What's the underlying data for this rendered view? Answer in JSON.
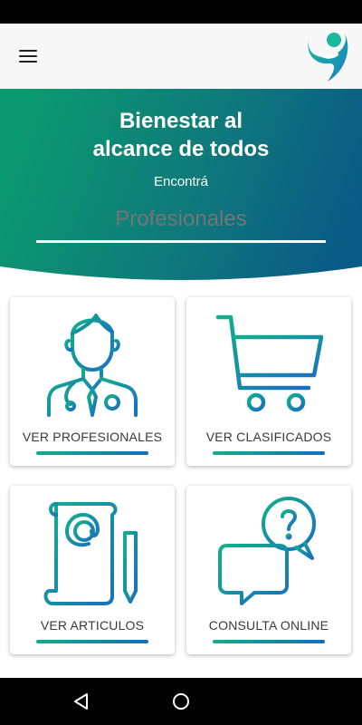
{
  "hero": {
    "title_line1": "Bienestar al",
    "title_line2": "alcance de todos",
    "subtitle": "Encontrá",
    "search_placeholder": "Profesionales"
  },
  "cards": [
    {
      "label": "VER PROFESIONALES",
      "icon": "doctor-icon"
    },
    {
      "label": "VER CLASIFICADOS",
      "icon": "shopping-cart-icon"
    },
    {
      "label": "VER ARTICULOS",
      "icon": "article-document-icon"
    },
    {
      "label": "CONSULTA ONLINE",
      "icon": "chat-question-icon"
    }
  ],
  "colors": {
    "gradient_start": "#0fae8c",
    "gradient_end": "#1470b8",
    "hero_start": "#0b9a6f",
    "hero_end": "#0a5a86"
  },
  "icons": {
    "menu": "hamburger-menu-icon",
    "logo": "app-logo",
    "nav_back": "back-triangle-icon",
    "nav_home": "home-circle-icon"
  }
}
